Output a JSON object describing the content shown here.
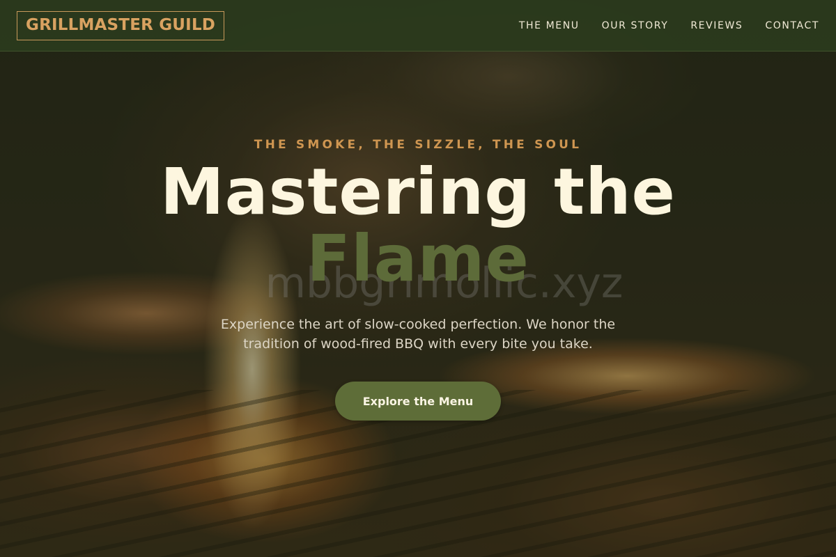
{
  "header": {
    "logo": "GRILLMASTER GUILD",
    "nav": [
      {
        "label": "THE MENU"
      },
      {
        "label": "OUR STORY"
      },
      {
        "label": "REVIEWS"
      },
      {
        "label": "CONTACT"
      }
    ]
  },
  "hero": {
    "tagline": "THE SMOKE, THE SIZZLE, THE SOUL",
    "headline_main": "Mastering the",
    "headline_accent": "Flame",
    "watermark": "mbbgrimollic.xyz",
    "subtitle": "Experience the art of slow-cooked perfection. We honor the tradition of wood-fired BBQ with every bite you take.",
    "cta_label": "Explore the Menu"
  },
  "colors": {
    "navbar_bg": "#2b3a1c",
    "logo_accent": "#d9a261",
    "tagline": "#cf9651",
    "headline": "#fdf6df",
    "headline_accent": "#5d6b39",
    "cta_bg": "#5e6d38"
  }
}
